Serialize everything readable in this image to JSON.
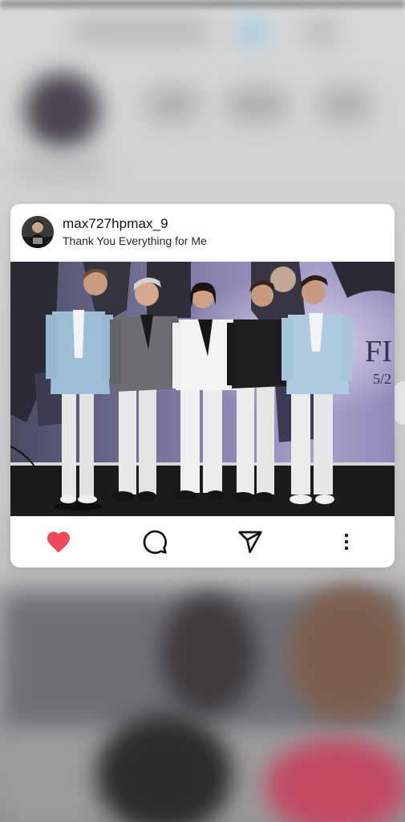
{
  "post": {
    "username": "max727hpmax_9",
    "caption": "Thank You Everything for Me",
    "photo_backdrop_text": "FI",
    "photo_backdrop_date": "5/2"
  },
  "actions": [
    {
      "name": "like",
      "icon": "heart-icon",
      "state": "liked",
      "color": "#ed4956"
    },
    {
      "name": "comment",
      "icon": "comment-icon"
    },
    {
      "name": "share",
      "icon": "send-icon"
    },
    {
      "name": "more",
      "icon": "more-vertical-icon"
    }
  ],
  "colors": {
    "card": "#ffffff",
    "text": "#141414",
    "like": "#ed4956",
    "backdrop_purple": "#8f88b4"
  }
}
